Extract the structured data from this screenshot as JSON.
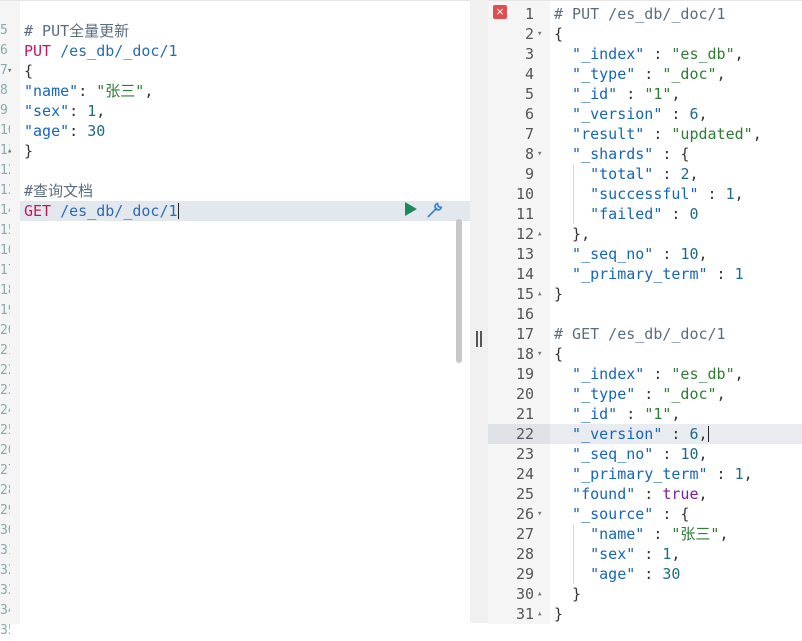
{
  "request_editor": {
    "lines": [
      {
        "no": "5",
        "parts": [
          {
            "t": "# PUT全量更新",
            "c": "comment"
          }
        ]
      },
      {
        "no": "6",
        "parts": [
          {
            "t": "PUT",
            "c": "method"
          },
          {
            "t": " /es_db/_doc/1",
            "c": "path"
          }
        ]
      },
      {
        "no": "7",
        "fold": "▾",
        "parts": [
          {
            "t": "{",
            "c": "punc"
          }
        ]
      },
      {
        "no": "8",
        "parts": [
          {
            "t": "\"name\"",
            "c": "key"
          },
          {
            "t": ": ",
            "c": "punc"
          },
          {
            "t": "\"张三\"",
            "c": "str"
          },
          {
            "t": ",",
            "c": "punc"
          }
        ]
      },
      {
        "no": "9",
        "parts": [
          {
            "t": "\"sex\"",
            "c": "key"
          },
          {
            "t": ": ",
            "c": "punc"
          },
          {
            "t": "1",
            "c": "num"
          },
          {
            "t": ",",
            "c": "punc"
          }
        ]
      },
      {
        "no": "10",
        "parts": [
          {
            "t": "\"age\"",
            "c": "key"
          },
          {
            "t": ": ",
            "c": "punc"
          },
          {
            "t": "30",
            "c": "num"
          }
        ]
      },
      {
        "no": "11",
        "fold": "▴",
        "parts": [
          {
            "t": "}",
            "c": "punc"
          }
        ]
      },
      {
        "no": "12",
        "parts": []
      },
      {
        "no": "13",
        "parts": [
          {
            "t": "#查询文档",
            "c": "comment"
          }
        ]
      },
      {
        "no": "14",
        "active": true,
        "parts": [
          {
            "t": "GET",
            "c": "method"
          },
          {
            "t": " /es_db/_doc/1",
            "c": "path"
          }
        ]
      },
      {
        "no": "15",
        "parts": []
      },
      {
        "no": "16",
        "parts": []
      },
      {
        "no": "17",
        "parts": []
      },
      {
        "no": "18",
        "parts": []
      },
      {
        "no": "19",
        "parts": []
      },
      {
        "no": "20",
        "parts": []
      },
      {
        "no": "21",
        "parts": []
      },
      {
        "no": "22",
        "parts": []
      },
      {
        "no": "23",
        "parts": []
      },
      {
        "no": "24",
        "parts": []
      },
      {
        "no": "25",
        "parts": []
      },
      {
        "no": "26",
        "parts": []
      },
      {
        "no": "27",
        "parts": []
      },
      {
        "no": "28",
        "parts": []
      },
      {
        "no": "29",
        "parts": []
      },
      {
        "no": "30",
        "parts": []
      },
      {
        "no": "31",
        "parts": []
      },
      {
        "no": "32",
        "parts": []
      },
      {
        "no": "33",
        "parts": []
      },
      {
        "no": "34",
        "parts": []
      },
      {
        "no": "35",
        "parts": []
      }
    ],
    "icons": {
      "run": "play-icon",
      "settings": "wrench-icon"
    }
  },
  "response_viewer": {
    "error_marker": "×",
    "active_line": 22,
    "lines": [
      {
        "no": "1",
        "parts": [
          {
            "t": "# PUT /es_db/_doc/1",
            "c": "comment"
          }
        ]
      },
      {
        "no": "2",
        "fold": "▾",
        "parts": [
          {
            "t": "{",
            "c": "punc"
          }
        ]
      },
      {
        "no": "3",
        "parts": [
          {
            "t": "  \"_index\"",
            "c": "key"
          },
          {
            "t": " : ",
            "c": "punc"
          },
          {
            "t": "\"es_db\"",
            "c": "str"
          },
          {
            "t": ",",
            "c": "punc"
          }
        ]
      },
      {
        "no": "4",
        "parts": [
          {
            "t": "  \"_type\"",
            "c": "key"
          },
          {
            "t": " : ",
            "c": "punc"
          },
          {
            "t": "\"_doc\"",
            "c": "str"
          },
          {
            "t": ",",
            "c": "punc"
          }
        ]
      },
      {
        "no": "5",
        "parts": [
          {
            "t": "  \"_id\"",
            "c": "key"
          },
          {
            "t": " : ",
            "c": "punc"
          },
          {
            "t": "\"1\"",
            "c": "str"
          },
          {
            "t": ",",
            "c": "punc"
          }
        ]
      },
      {
        "no": "6",
        "parts": [
          {
            "t": "  \"_version\"",
            "c": "key"
          },
          {
            "t": " : ",
            "c": "punc"
          },
          {
            "t": "6",
            "c": "num"
          },
          {
            "t": ",",
            "c": "punc"
          }
        ]
      },
      {
        "no": "7",
        "parts": [
          {
            "t": "  \"result\"",
            "c": "key"
          },
          {
            "t": " : ",
            "c": "punc"
          },
          {
            "t": "\"updated\"",
            "c": "str"
          },
          {
            "t": ",",
            "c": "punc"
          }
        ]
      },
      {
        "no": "8",
        "fold": "▾",
        "parts": [
          {
            "t": "  \"_shards\"",
            "c": "key"
          },
          {
            "t": " : {",
            "c": "punc"
          }
        ]
      },
      {
        "no": "9",
        "parts": [
          {
            "t": "    \"total\"",
            "c": "key"
          },
          {
            "t": " : ",
            "c": "punc"
          },
          {
            "t": "2",
            "c": "num"
          },
          {
            "t": ",",
            "c": "punc"
          }
        ]
      },
      {
        "no": "10",
        "parts": [
          {
            "t": "    \"successful\"",
            "c": "key"
          },
          {
            "t": " : ",
            "c": "punc"
          },
          {
            "t": "1",
            "c": "num"
          },
          {
            "t": ",",
            "c": "punc"
          }
        ]
      },
      {
        "no": "11",
        "parts": [
          {
            "t": "    \"failed\"",
            "c": "key"
          },
          {
            "t": " : ",
            "c": "punc"
          },
          {
            "t": "0",
            "c": "num"
          }
        ]
      },
      {
        "no": "12",
        "fold": "▴",
        "parts": [
          {
            "t": "  },",
            "c": "punc"
          }
        ]
      },
      {
        "no": "13",
        "parts": [
          {
            "t": "  \"_seq_no\"",
            "c": "key"
          },
          {
            "t": " : ",
            "c": "punc"
          },
          {
            "t": "10",
            "c": "num"
          },
          {
            "t": ",",
            "c": "punc"
          }
        ]
      },
      {
        "no": "14",
        "parts": [
          {
            "t": "  \"_primary_term\"",
            "c": "key"
          },
          {
            "t": " : ",
            "c": "punc"
          },
          {
            "t": "1",
            "c": "num"
          }
        ]
      },
      {
        "no": "15",
        "fold": "▴",
        "parts": [
          {
            "t": "}",
            "c": "punc"
          }
        ]
      },
      {
        "no": "16",
        "parts": []
      },
      {
        "no": "17",
        "parts": [
          {
            "t": "# GET /es_db/_doc/1",
            "c": "comment"
          }
        ]
      },
      {
        "no": "18",
        "fold": "▾",
        "parts": [
          {
            "t": "{",
            "c": "punc"
          }
        ]
      },
      {
        "no": "19",
        "parts": [
          {
            "t": "  \"_index\"",
            "c": "key"
          },
          {
            "t": " : ",
            "c": "punc"
          },
          {
            "t": "\"es_db\"",
            "c": "str"
          },
          {
            "t": ",",
            "c": "punc"
          }
        ]
      },
      {
        "no": "20",
        "parts": [
          {
            "t": "  \"_type\"",
            "c": "key"
          },
          {
            "t": " : ",
            "c": "punc"
          },
          {
            "t": "\"_doc\"",
            "c": "str"
          },
          {
            "t": ",",
            "c": "punc"
          }
        ]
      },
      {
        "no": "21",
        "parts": [
          {
            "t": "  \"_id\"",
            "c": "key"
          },
          {
            "t": " : ",
            "c": "punc"
          },
          {
            "t": "\"1\"",
            "c": "str"
          },
          {
            "t": ",",
            "c": "punc"
          }
        ]
      },
      {
        "no": "22",
        "parts": [
          {
            "t": "  \"_version\"",
            "c": "key"
          },
          {
            "t": " : ",
            "c": "punc"
          },
          {
            "t": "6",
            "c": "num"
          },
          {
            "t": ",",
            "c": "punc"
          }
        ]
      },
      {
        "no": "23",
        "parts": [
          {
            "t": "  \"_seq_no\"",
            "c": "key"
          },
          {
            "t": " : ",
            "c": "punc"
          },
          {
            "t": "10",
            "c": "num"
          },
          {
            "t": ",",
            "c": "punc"
          }
        ]
      },
      {
        "no": "24",
        "parts": [
          {
            "t": "  \"_primary_term\"",
            "c": "key"
          },
          {
            "t": " : ",
            "c": "punc"
          },
          {
            "t": "1",
            "c": "num"
          },
          {
            "t": ",",
            "c": "punc"
          }
        ]
      },
      {
        "no": "25",
        "parts": [
          {
            "t": "  \"found\"",
            "c": "key"
          },
          {
            "t": " : ",
            "c": "punc"
          },
          {
            "t": "true",
            "c": "bool"
          },
          {
            "t": ",",
            "c": "punc"
          }
        ]
      },
      {
        "no": "26",
        "fold": "▾",
        "parts": [
          {
            "t": "  \"_source\"",
            "c": "key"
          },
          {
            "t": " : {",
            "c": "punc"
          }
        ]
      },
      {
        "no": "27",
        "parts": [
          {
            "t": "    \"name\"",
            "c": "key"
          },
          {
            "t": " : ",
            "c": "punc"
          },
          {
            "t": "\"张三\"",
            "c": "str"
          },
          {
            "t": ",",
            "c": "punc"
          }
        ]
      },
      {
        "no": "28",
        "parts": [
          {
            "t": "    \"sex\"",
            "c": "key"
          },
          {
            "t": " : ",
            "c": "punc"
          },
          {
            "t": "1",
            "c": "num"
          },
          {
            "t": ",",
            "c": "punc"
          }
        ]
      },
      {
        "no": "29",
        "parts": [
          {
            "t": "    \"age\"",
            "c": "key"
          },
          {
            "t": " : ",
            "c": "punc"
          },
          {
            "t": "30",
            "c": "num"
          }
        ]
      },
      {
        "no": "30",
        "fold": "▴",
        "parts": [
          {
            "t": "  }",
            "c": "punc"
          }
        ]
      },
      {
        "no": "31",
        "fold": "▴",
        "parts": [
          {
            "t": "}",
            "c": "punc"
          }
        ]
      }
    ]
  },
  "colors": {
    "method": "#c2185b",
    "path": "#2b6cb0",
    "key": "#1565c0",
    "string": "#2e7d32",
    "number": "#1e6b86",
    "comment": "#5a6d7e",
    "boolean": "#7b1fa2",
    "error": "#e04f4f",
    "run": "#1b8a5a"
  }
}
